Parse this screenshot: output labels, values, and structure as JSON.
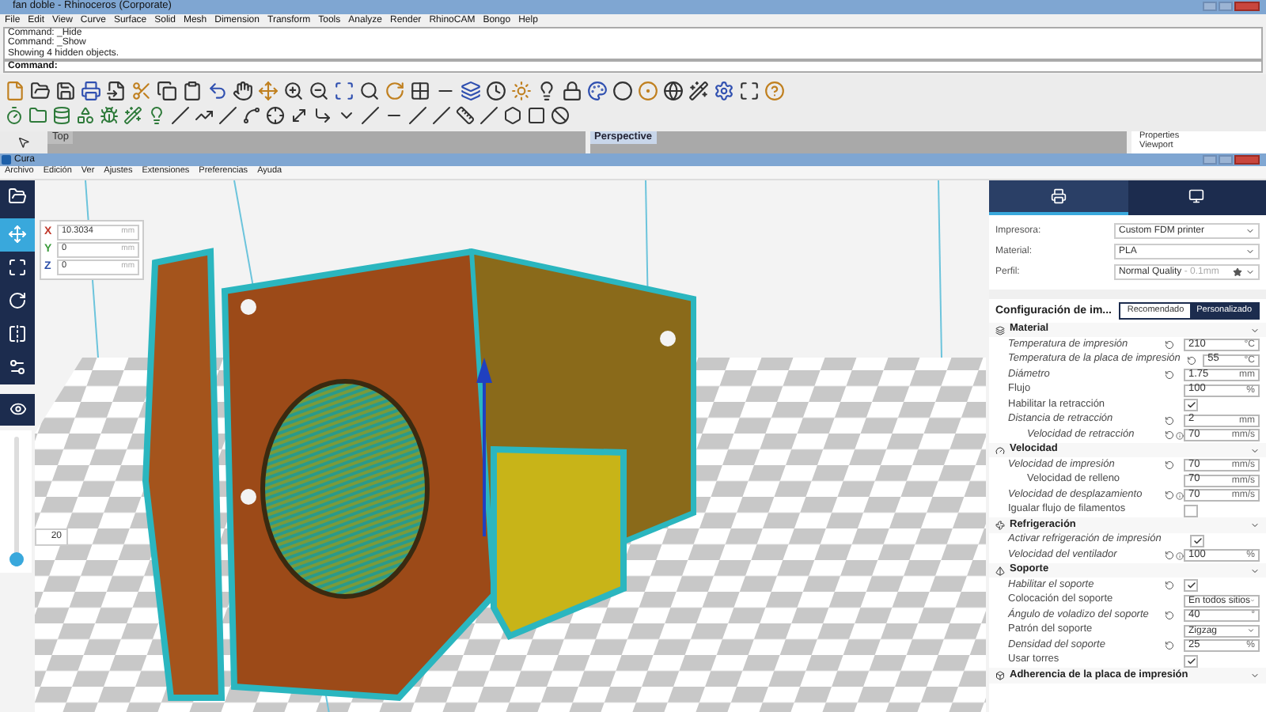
{
  "rhino": {
    "title": "fan doble - Rhinoceros (Corporate)",
    "menu": [
      "File",
      "Edit",
      "View",
      "Curve",
      "Surface",
      "Solid",
      "Mesh",
      "Dimension",
      "Transform",
      "Tools",
      "Analyze",
      "Render",
      "RhinoCAM",
      "Bongo",
      "Help"
    ],
    "command_history": [
      "Command: _Hide",
      "Command: _Show",
      "Showing 4 hidden objects."
    ],
    "command_prompt": "Command:",
    "viewports": [
      {
        "label": "Top",
        "selected": false
      },
      {
        "label": "Perspective",
        "selected": true
      }
    ],
    "panel_tabs": [
      "Properties",
      "Viewport"
    ]
  },
  "cura": {
    "title": "Cura",
    "menu": [
      "Archivo",
      "Edición",
      "Ver",
      "Ajustes",
      "Extensiones",
      "Preferencias",
      "Ayuda"
    ],
    "tools": [
      {
        "kind": "open",
        "selected": false
      },
      {
        "kind": "move",
        "selected": true
      },
      {
        "kind": "scale",
        "selected": false
      },
      {
        "kind": "rotate",
        "selected": false
      },
      {
        "kind": "mirror",
        "selected": false
      },
      {
        "kind": "per-model",
        "selected": false
      }
    ],
    "position": [
      {
        "axis": "X",
        "value": "10.3034",
        "unit": "mm",
        "color": "#c0392b"
      },
      {
        "axis": "Y",
        "value": "0",
        "unit": "mm",
        "color": "#3a9a3a"
      },
      {
        "axis": "Z",
        "value": "0",
        "unit": "mm",
        "color": "#2c4fa8"
      }
    ],
    "layer_view": {
      "level": 0.05,
      "value": "20"
    },
    "panel": {
      "tabs": [
        {
          "kind": "print-setup",
          "selected": true
        },
        {
          "kind": "monitor",
          "selected": false
        }
      ],
      "fields": [
        {
          "label": "Impresora:",
          "value": "Custom FDM printer"
        },
        {
          "label": "Material:",
          "value": "PLA"
        },
        {
          "label": "Perfil:",
          "value": "Normal Quality",
          "detail": " - 0.1mm",
          "favorite": true
        }
      ],
      "settings_title": "Configuración de im...",
      "modes": [
        {
          "label": "Recomendado",
          "selected": false
        },
        {
          "label": "Personalizado",
          "selected": true
        }
      ],
      "sections": [
        {
          "title": "Material",
          "kind": "material",
          "settings": [
            {
              "label": "Temperatura de impresión",
              "italic": true,
              "kind": "number",
              "value": "210",
              "unit": "°C",
              "reset": true,
              "info": false
            },
            {
              "label": "Temperatura de la placa de impresión",
              "italic": true,
              "kind": "number",
              "value": "55",
              "unit": "°C",
              "reset": true,
              "info": false
            },
            {
              "label": "Diámetro",
              "italic": true,
              "kind": "number",
              "value": "1.75",
              "unit": "mm",
              "reset": true,
              "info": false
            },
            {
              "label": "Flujo",
              "italic": false,
              "kind": "number",
              "value": "100",
              "unit": "%",
              "reset": false,
              "info": false
            },
            {
              "label": "Habilitar la retracción",
              "italic": false,
              "kind": "check",
              "checked": true,
              "reset": false,
              "info": false
            },
            {
              "label": "Distancia de retracción",
              "italic": true,
              "kind": "number",
              "value": "2",
              "unit": "mm",
              "reset": true,
              "info": false,
              "children": [
                {
                  "label": "Velocidad de retracción",
                  "italic": true,
                  "kind": "number",
                  "value": "70",
                  "unit": "mm/s",
                  "reset": true,
                  "info": true
                }
              ]
            }
          ]
        },
        {
          "title": "Velocidad",
          "kind": "speed",
          "settings": [
            {
              "label": "Velocidad de impresión",
              "italic": true,
              "kind": "number",
              "value": "70",
              "unit": "mm/s",
              "reset": true,
              "info": false,
              "children": [
                {
                  "label": "Velocidad de relleno",
                  "italic": false,
                  "kind": "number",
                  "value": "70",
                  "unit": "mm/s",
                  "reset": false,
                  "info": false
                }
              ]
            },
            {
              "label": "Velocidad de desplazamiento",
              "italic": true,
              "kind": "number",
              "value": "70",
              "unit": "mm/s",
              "reset": true,
              "info": true
            },
            {
              "label": "Igualar flujo de filamentos",
              "italic": false,
              "kind": "check",
              "checked": false,
              "reset": false,
              "info": false
            }
          ]
        },
        {
          "title": "Refrigeración",
          "kind": "cooling",
          "settings": [
            {
              "label": "Activar refrigeración de impresión",
              "italic": true,
              "kind": "check",
              "checked": true,
              "reset": false,
              "info": false
            },
            {
              "label": "Velocidad del ventilador",
              "italic": true,
              "kind": "number",
              "value": "100",
              "unit": "%",
              "reset": true,
              "info": true
            }
          ]
        },
        {
          "title": "Soporte",
          "kind": "support",
          "settings": [
            {
              "label": "Habilitar el soporte",
              "italic": true,
              "kind": "check",
              "checked": true,
              "reset": true,
              "info": false
            },
            {
              "label": "Colocación del soporte",
              "italic": false,
              "kind": "select",
              "value": "En todos sitios",
              "reset": false,
              "info": false
            },
            {
              "label": "Ángulo de voladizo del soporte",
              "italic": true,
              "kind": "number",
              "value": "40",
              "unit": "°",
              "reset": true,
              "info": false
            },
            {
              "label": "Patrón del soporte",
              "italic": false,
              "kind": "select",
              "value": "Zigzag",
              "reset": false,
              "info": false
            },
            {
              "label": "Densidad del soporte",
              "italic": true,
              "kind": "number",
              "value": "25",
              "unit": "%",
              "reset": true,
              "info": false
            },
            {
              "label": "Usar torres",
              "italic": false,
              "kind": "check",
              "checked": true,
              "reset": false,
              "info": false
            }
          ]
        },
        {
          "title": "Adherencia de la placa de impresión",
          "kind": "adhesion"
        }
      ]
    }
  }
}
